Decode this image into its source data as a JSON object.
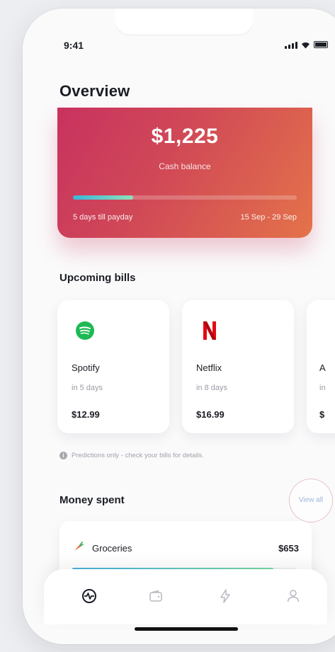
{
  "status_bar": {
    "time": "9:41"
  },
  "header": {
    "title": "Overview"
  },
  "cash_card": {
    "amount": "$1,225",
    "label": "Cash balance",
    "progress": 0.27,
    "payday_text": "5 days till payday",
    "period": "15 Sep - 29 Sep"
  },
  "upcoming_bills": {
    "title": "Upcoming bills",
    "items": [
      {
        "name": "Spotify",
        "due": "in 5 days",
        "amount": "$12.99",
        "icon": "spotify-logo"
      },
      {
        "name": "Netflix",
        "due": "in 8 days",
        "amount": "$16.99",
        "icon": "netflix-logo"
      },
      {
        "name": "A",
        "due": "in",
        "amount": "$",
        "icon": "unknown"
      }
    ],
    "note": "Predictions only - check your bills for details."
  },
  "money_spent": {
    "title": "Money spent",
    "view_all": "View all",
    "categories": [
      {
        "name": "Groceries",
        "amount": "$653",
        "icon": "carrot-icon",
        "progress": 0.9
      }
    ]
  },
  "tab_bar": {
    "tabs": [
      "activity",
      "wallet",
      "flash",
      "profile"
    ]
  },
  "colors": {
    "card_gradient": [
      "#c8325f",
      "#e4734a"
    ],
    "progress_gradient": [
      "#3ab7d8",
      "#8fe0b8"
    ],
    "spotify_green": "#1DB954",
    "netflix_red": "#E50914"
  }
}
